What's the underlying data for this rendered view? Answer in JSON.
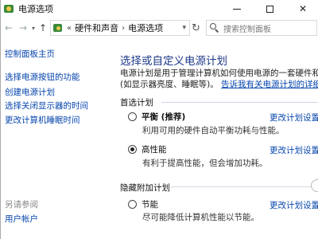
{
  "window": {
    "title": "电源选项"
  },
  "navbar": {
    "path_prefix": "«",
    "crumbs": [
      "硬件和声音",
      "电源选项"
    ],
    "search_placeholder": "搜索控制面板"
  },
  "left": {
    "home": "控制面板主页",
    "links": [
      "选择电源按钮的功能",
      "创建电源计划",
      "选择关闭显示器的时间",
      "更改计算机睡眠时间"
    ],
    "see_also": "另请参阅",
    "user_accounts": "用户帐户"
  },
  "main": {
    "title": "选择或自定义电源计划",
    "desc_line1": "电源计划是用于管理计算机如何使用电源的一套硬件和系统设置",
    "desc_line2_prefix": "(如显示器亮度、睡眠等)。",
    "desc_link": "告诉我有关电源计划的详细信息",
    "preferred_label": "首选计划",
    "hidden_label": "隐藏附加计划",
    "edit_label": "更改计划设置",
    "plans": [
      {
        "name": "平衡 (推荐)",
        "desc": "利用可用的硬件自动平衡功耗与性能。",
        "selected": false,
        "bold": true
      },
      {
        "name": "高性能",
        "desc": "有利于提高性能，但会增加功耗。",
        "selected": true,
        "bold": false
      },
      {
        "name": "节能",
        "desc": "尽可能降低计算机性能以节能。",
        "selected": false,
        "bold": false
      }
    ]
  },
  "colors": {
    "link": "#0645ad",
    "title": "#1e3a8a",
    "separator": "#cfd6e0"
  }
}
